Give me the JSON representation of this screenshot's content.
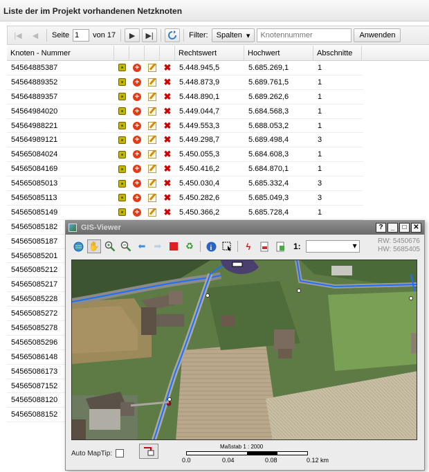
{
  "panel": {
    "title": "Liste der im Projekt vorhandenen Netzknoten"
  },
  "toolbar": {
    "page_label": "Seite",
    "page_value": "1",
    "of_label": "von 17",
    "filter_label": "Filter:",
    "columns_button": "Spalten",
    "filter_placeholder": "Knotennummer",
    "apply_button": "Anwenden"
  },
  "grid": {
    "columns": [
      "Knoten - Nummer",
      "Rechtswert",
      "Hochwert",
      "Abschnitte"
    ],
    "rows": [
      [
        "54564885387",
        "5.448.945,5",
        "5.685.269,1",
        "1"
      ],
      [
        "54564889352",
        "5.448.873,9",
        "5.689.761,5",
        "1"
      ],
      [
        "54564889357",
        "5.448.890,1",
        "5.689.262,6",
        "1"
      ],
      [
        "54564984020",
        "5.449.044,7",
        "5.684.568,3",
        "1"
      ],
      [
        "54564988221",
        "5.449.553,3",
        "5.688.053,2",
        "1"
      ],
      [
        "54564989121",
        "5.449.298,7",
        "5.689.498,4",
        "3"
      ],
      [
        "54565084024",
        "5.450.055,3",
        "5.684.608,3",
        "1"
      ],
      [
        "54565084169",
        "5.450.416,2",
        "5.684.870,1",
        "1"
      ],
      [
        "54565085013",
        "5.450.030,4",
        "5.685.332,4",
        "3"
      ],
      [
        "54565085113",
        "5.450.282,6",
        "5.685.049,3",
        "3"
      ],
      [
        "54565085149",
        "5.450.366,2",
        "5.685.728,4",
        "1"
      ],
      [
        "54565085182",
        "",
        "",
        ""
      ],
      [
        "54565085187",
        "",
        "",
        ""
      ],
      [
        "54565085201",
        "",
        "",
        ""
      ],
      [
        "54565085212",
        "",
        "",
        ""
      ],
      [
        "54565085217",
        "",
        "",
        ""
      ],
      [
        "54565085228",
        "",
        "",
        ""
      ],
      [
        "54565085272",
        "",
        "",
        ""
      ],
      [
        "54565085278",
        "",
        "",
        ""
      ],
      [
        "54565085296",
        "",
        "",
        ""
      ],
      [
        "54565086148",
        "",
        "",
        ""
      ],
      [
        "54565086173",
        "",
        "",
        ""
      ],
      [
        "54565087152",
        "",
        "",
        ""
      ],
      [
        "54565088120",
        "",
        "",
        ""
      ],
      [
        "54565088152",
        "",
        "",
        ""
      ]
    ]
  },
  "gis": {
    "title": "GIS-Viewer",
    "controls": [
      "?",
      "_",
      "□",
      "✕"
    ],
    "scale_label": "1:",
    "rw": "RW: 5450676",
    "hw": "HW: 5685405",
    "auto_maptip": "Auto MapTip:",
    "scalebar_title": "Maßstab 1 : 2000",
    "scalebar_ticks": [
      "0.0",
      "0.04",
      "0.08",
      "0.12 km"
    ]
  }
}
